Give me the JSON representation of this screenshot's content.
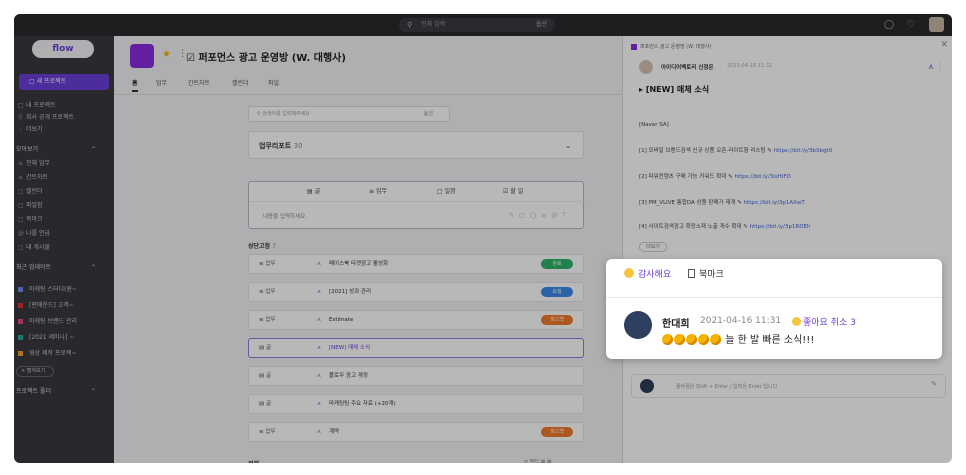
{
  "topbar": {
    "search_placeholder": "전체 검색",
    "search_option": "옵션"
  },
  "sidebar": {
    "logo": "flow",
    "new_project": "새 프로젝트",
    "menu": [
      "내 프로젝트",
      "회사 공개 프로젝트",
      "더보기"
    ],
    "section_view": "모아보기",
    "view_items": [
      "전체 업무",
      "간트차트",
      "캘린더",
      "파일함",
      "북마크",
      "나를 언급",
      "내 게시물"
    ],
    "section_recent": "최근 업데이트",
    "recent_items": [
      {
        "label": "마케팅 스터디(원~",
        "color": "#6b8fe8"
      },
      {
        "label": "[판매운드] 고객~",
        "color": "#d7353a"
      },
      {
        "label": "마케팅 브랜드 관리",
        "color": "#e8458b"
      },
      {
        "label": "[2021 세미나] ~",
        "color": "#22a99b"
      },
      {
        "label": "영상 제작 프로젝~",
        "color": "#f0a12a"
      }
    ],
    "more_btn": "+ 펼쳐보기",
    "section_folder": "프로젝트 폴더"
  },
  "main": {
    "project_title": "퍼포먼스 광고 운영방 (W. 대행사)",
    "tabs": [
      "홈",
      "업무",
      "간트차트",
      "캘린더",
      "파일"
    ],
    "inner_search_placeholder": "검색어를 입력해주세요",
    "inner_search_option": "옵션",
    "feed_label": "업무리포트",
    "feed_count": "30",
    "composer_tabs": [
      "글",
      "업무",
      "일정",
      "할 일"
    ],
    "composer_placeholder": "내용을 입력하세요.",
    "fixed_label": "상단고정",
    "fixed_count": "7",
    "rows": [
      {
        "type": "업무",
        "title": "페이스북 타겟광고 활성화",
        "badge": "완료",
        "badge_color": "#2fb36b"
      },
      {
        "type": "업무",
        "title": "[2021] 성과 관리",
        "badge": "요청",
        "badge_color": "#3b8be8"
      },
      {
        "type": "업무",
        "title": "Estimate",
        "badge": "피드백",
        "badge_color": "#f07a2a"
      },
      {
        "type": "글",
        "title": "[NEW] 매체 소식",
        "badge": "",
        "badge_color": ""
      },
      {
        "type": "글",
        "title": "플로우 광고 계정",
        "badge": "",
        "badge_color": ""
      },
      {
        "type": "글",
        "title": "마케팅팀 주요 자료 (+20개)",
        "badge": "",
        "badge_color": ""
      },
      {
        "type": "업무",
        "title": "계약",
        "badge": "피드백",
        "badge_color": "#f07a2a"
      }
    ],
    "all_label": "전체",
    "filter_label": "필터"
  },
  "panel": {
    "header": "퍼포먼스 광고 운영방 (W. 대행사)",
    "author": "아이디어벡토리 신정은",
    "date": "2021-04-16 11:31",
    "post_title": "[NEW] 매체 소식",
    "lines": [
      {
        "text": "[Naver SA]",
        "link": ""
      },
      {
        "text": "[1] 모바일 브랜드검색 신규 상품 오픈-라이트형 리스팅",
        "link": "https://bit.ly/3bXbgt0"
      },
      {
        "text": "[2] 파워컨텐츠 구매 가능 키워드 확대",
        "link": "https://bit.ly/3isHIFD"
      },
      {
        "text": "[3] PM_VLIVE 통합DA 상품 판매가 재개",
        "link": "https://bit.ly/3p1AXwT"
      },
      {
        "text": "[4] 사이트검색광고 확장소재 노출 개수 확대",
        "link": "https://bit.ly/3p1RDEh"
      }
    ],
    "more_btn": "더보기",
    "composer_placeholder": "줄바꿈은 Shift + Enter / 입력은 Enter 입니다."
  },
  "popup": {
    "thanks_label": "감사해요",
    "bookmark_label": "북마크",
    "commenter": "한대희",
    "comment_date": "2021-04-16 11:31",
    "like_label": "좋아요 취소",
    "like_count": "3",
    "comment_text": "늘 한 발 빠른 소식!!!"
  },
  "colors": {
    "accent": "#6b3fd8",
    "sidebar_bg": "#3a3a3f",
    "topbar_bg": "#2a2a2e"
  }
}
